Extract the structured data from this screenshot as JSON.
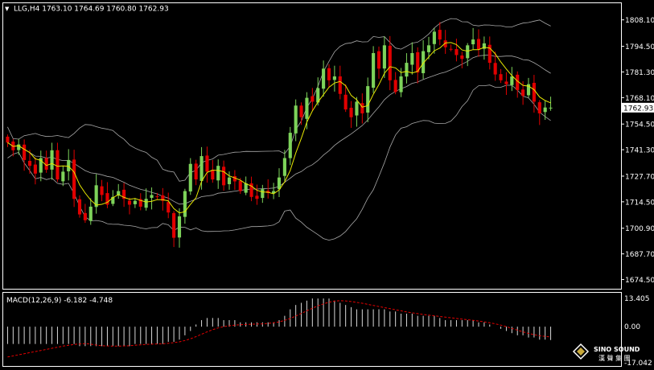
{
  "colors": {
    "background": "#000000",
    "frame": "#ffffff",
    "bull_candle": "#7dd35a",
    "bear_candle": "#e10000",
    "ma": "#e8e800",
    "bands": "#a8a8a8",
    "macd_hist": "#d9d9d9",
    "macd_signal": "#e40000",
    "current_price_tag_bg": "#ffffff",
    "current_price_tag_text": "#000000"
  },
  "header": {
    "menu_glyph": "▼",
    "text": "LLG,H4  1763.10 1764.69 1760.80 1762.93"
  },
  "macd": {
    "title": "MACD(12,26,9) -6.182 -4.748",
    "scale_labels": [
      "13.405",
      "0.00",
      "-17.042"
    ]
  },
  "logo": {
    "line1": "SINO SOUND",
    "line2": "漢 聲 集 團",
    "icon": "diamond-logo-icon"
  },
  "chart_data": [
    {
      "type": "candlestick",
      "title": "",
      "symbol": "LLG",
      "timeframe": "H4",
      "ohlc_last": {
        "open": 1763.1,
        "high": 1764.69,
        "low": 1760.8,
        "close": 1762.93
      },
      "current_price_label": "1762.93",
      "ylim": [
        1671.0,
        1815.0
      ],
      "y_ticks": [
        1808.1,
        1794.5,
        1781.3,
        1768.1,
        1754.5,
        1741.3,
        1727.7,
        1714.5,
        1700.9,
        1687.7,
        1674.5
      ],
      "y_tick_labels": [
        "1808.10",
        "1794.50",
        "1781.30",
        "1768.10",
        "1754.50",
        "1741.30",
        "1727.70",
        "1714.50",
        "1700.90",
        "1687.70",
        "1674.50"
      ],
      "close_series": [
        1745,
        1741,
        1744,
        1736,
        1733,
        1729,
        1737,
        1731,
        1741,
        1726,
        1730,
        1736,
        1716,
        1708,
        1705,
        1712,
        1723,
        1718,
        1713,
        1717,
        1720,
        1716,
        1713,
        1715,
        1712,
        1716,
        1718,
        1717,
        1715,
        1709,
        1696,
        1707,
        1720,
        1734,
        1726,
        1738,
        1730,
        1726,
        1733,
        1723,
        1727,
        1725,
        1720,
        1724,
        1717,
        1716,
        1721,
        1719,
        1720,
        1727,
        1737,
        1750,
        1764,
        1758,
        1768,
        1766,
        1773,
        1783,
        1777,
        1779,
        1770,
        1762,
        1758,
        1766,
        1760,
        1774,
        1791,
        1783,
        1795,
        1777,
        1771,
        1779,
        1786,
        1791,
        1781,
        1792,
        1795,
        1802,
        1798,
        1794,
        1793,
        1790,
        1788,
        1795,
        1798,
        1793,
        1796,
        1786,
        1780,
        1777,
        1775,
        1779,
        1772,
        1769,
        1775,
        1766,
        1760,
        1763,
        1762.93
      ],
      "ma_period": 5,
      "bollinger": {
        "period": 20,
        "stddev": 2
      }
    },
    {
      "type": "bar",
      "title": "MACD(12,26,9)",
      "macd_value": -6.182,
      "signal_value": -4.748,
      "ylim": [
        -17.042,
        13.405
      ],
      "hist": [
        -8,
        -8,
        -8,
        -8,
        -8,
        -8,
        -8,
        -8,
        -8,
        -8,
        -8,
        -8,
        -8,
        -9,
        -9,
        -9,
        -9,
        -9,
        -9,
        -9,
        -9,
        -9,
        -9,
        -8,
        -8,
        -8,
        -8,
        -8,
        -8,
        -7,
        -7,
        -6,
        -4,
        -2,
        1,
        3,
        4,
        4,
        4,
        3,
        3,
        3,
        2,
        2,
        2,
        2,
        2,
        2,
        2,
        3,
        5,
        8,
        10,
        11,
        12,
        13,
        13,
        13,
        13,
        12,
        11,
        10,
        9,
        8,
        8,
        8,
        8,
        8,
        8,
        7,
        7,
        6,
        6,
        6,
        5,
        5,
        5,
        5,
        4,
        3,
        3,
        3,
        3,
        3,
        3,
        2,
        2,
        1,
        0,
        -1,
        -2,
        -3,
        -4,
        -4,
        -5,
        -5,
        -6,
        -6,
        -6.182
      ],
      "signal": [
        -14,
        -13.5,
        -13,
        -12.5,
        -12,
        -11.5,
        -11,
        -10.5,
        -10,
        -9.5,
        -9,
        -8.6,
        -8.2,
        -8,
        -7.8,
        -8.1,
        -8.5,
        -8.8,
        -8.9,
        -9,
        -9,
        -8.9,
        -8.8,
        -8.6,
        -8.4,
        -8.2,
        -8.1,
        -8,
        -7.9,
        -7.7,
        -7.4,
        -7,
        -6.4,
        -5.6,
        -4.6,
        -3.5,
        -2.4,
        -1.4,
        -0.6,
        0,
        0.4,
        0.7,
        0.9,
        1,
        1.1,
        1.2,
        1.3,
        1.5,
        1.8,
        2.2,
        2.9,
        3.8,
        4.9,
        6.1,
        7.3,
        8.5,
        9.6,
        10.5,
        11.3,
        11.8,
        12,
        11.9,
        11.6,
        11.2,
        10.8,
        10.3,
        9.8,
        9.3,
        8.8,
        8.3,
        7.8,
        7.3,
        6.8,
        6.4,
        6,
        5.6,
        5.3,
        5,
        4.7,
        4.4,
        4.1,
        3.8,
        3.5,
        3.2,
        2.9,
        2.6,
        2.2,
        1.8,
        1.3,
        0.7,
        0,
        -0.8,
        -1.6,
        -2.4,
        -3.1,
        -3.7,
        -4.2,
        -4.5,
        -4.748
      ]
    }
  ]
}
